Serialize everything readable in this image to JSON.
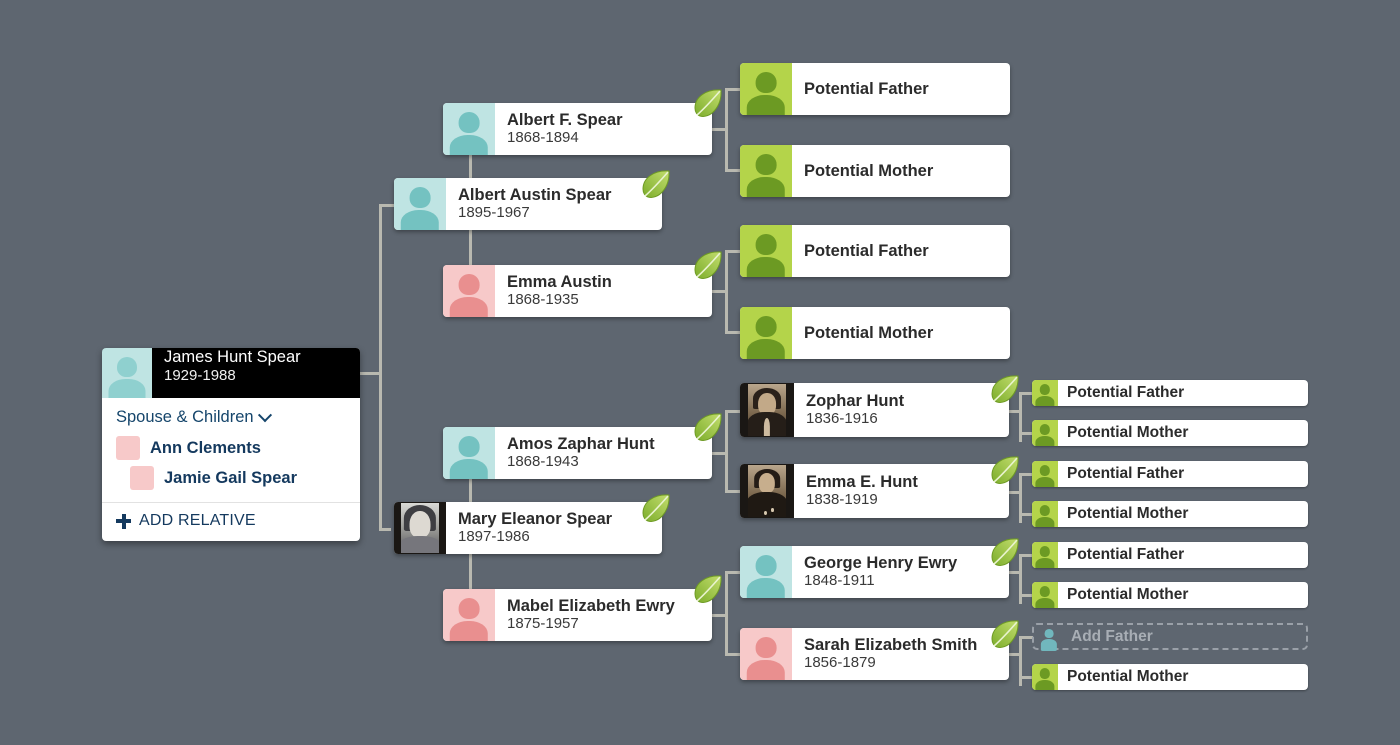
{
  "theme": {
    "background": "#5e6670",
    "connector": "#b9b9b0",
    "card_bg": "#ffffff",
    "focus_header_bg": "#000000",
    "male_avatar": "#bfe4e3",
    "female_avatar": "#f7c9c9",
    "potential_avatar": "#b4d44a",
    "link_text": "#14395e",
    "placeholder_text": "#a8aeb5"
  },
  "focus_person": {
    "name": "James Hunt Spear",
    "years": "1929-1988",
    "avatar_icon": "male-silhouette-icon",
    "section_label": "Spouse & Children",
    "chevron_icon": "chevron-down-icon",
    "relatives": [
      {
        "name": "Ann Clements",
        "relation": "spouse",
        "avatar_icon": "female-silhouette-icon"
      },
      {
        "name": "Jamie Gail Spear",
        "relation": "child",
        "avatar_icon": "female-silhouette-icon"
      }
    ],
    "add_relative_label": "ADD RELATIVE",
    "add_icon": "plus-icon"
  },
  "generation_2": [
    {
      "id": "albert-austin-spear",
      "name": "Albert Austin Spear",
      "years": "1895-1967",
      "avatar": "male",
      "avatar_icon": "male-silhouette-icon",
      "hint_icon": "leaf-hint-icon"
    },
    {
      "id": "mary-eleanor-spear",
      "name": "Mary Eleanor Spear",
      "years": "1897-1986",
      "avatar": "photo-gray",
      "avatar_icon": "portrait-photo",
      "hint_icon": "leaf-hint-icon"
    }
  ],
  "generation_3": [
    {
      "id": "albert-f-spear",
      "name": "Albert F. Spear",
      "years": "1868-1894",
      "avatar": "male",
      "avatar_icon": "male-silhouette-icon",
      "hint_icon": "leaf-hint-icon"
    },
    {
      "id": "emma-austin",
      "name": "Emma Austin",
      "years": "1868-1935",
      "avatar": "female",
      "avatar_icon": "female-silhouette-icon",
      "hint_icon": "leaf-hint-icon"
    },
    {
      "id": "amos-zaphar-hunt",
      "name": "Amos Zaphar Hunt",
      "years": "1868-1943",
      "avatar": "male",
      "avatar_icon": "male-silhouette-icon",
      "hint_icon": "leaf-hint-icon"
    },
    {
      "id": "mabel-elizabeth-ewry",
      "name": "Mabel Elizabeth Ewry",
      "years": "1875-1957",
      "avatar": "female",
      "avatar_icon": "female-silhouette-icon",
      "hint_icon": "leaf-hint-icon"
    }
  ],
  "generation_4": [
    {
      "id": "zophar-hunt",
      "name": "Zophar Hunt",
      "years": "1836-1916",
      "avatar": "photo-sepia",
      "avatar_icon": "portrait-photo",
      "hint_icon": "leaf-hint-icon"
    },
    {
      "id": "emma-e-hunt",
      "name": "Emma E. Hunt",
      "years": "1838-1919",
      "avatar": "photo-sepia",
      "avatar_icon": "portrait-photo",
      "hint_icon": "leaf-hint-icon"
    },
    {
      "id": "george-henry-ewry",
      "name": "George Henry Ewry",
      "years": "1848-1911",
      "avatar": "male",
      "avatar_icon": "male-silhouette-icon",
      "hint_icon": "leaf-hint-icon"
    },
    {
      "id": "sarah-elizabeth-smith",
      "name": "Sarah Elizabeth Smith",
      "years": "1856-1879",
      "avatar": "female",
      "avatar_icon": "female-silhouette-icon",
      "hint_icon": "leaf-hint-icon"
    }
  ],
  "potential_large": [
    {
      "id": "pf-1",
      "label": "Potential Father",
      "avatar_icon": "potential-father-icon"
    },
    {
      "id": "pm-1",
      "label": "Potential Mother",
      "avatar_icon": "potential-mother-icon"
    },
    {
      "id": "pf-2",
      "label": "Potential Father",
      "avatar_icon": "potential-father-icon"
    },
    {
      "id": "pm-2",
      "label": "Potential Mother",
      "avatar_icon": "potential-mother-icon"
    }
  ],
  "potential_small": [
    {
      "id": "pf-3",
      "label": "Potential Father",
      "avatar_icon": "potential-father-icon"
    },
    {
      "id": "pm-3",
      "label": "Potential Mother",
      "avatar_icon": "potential-mother-icon"
    },
    {
      "id": "pf-4",
      "label": "Potential Father",
      "avatar_icon": "potential-father-icon"
    },
    {
      "id": "pm-4",
      "label": "Potential Mother",
      "avatar_icon": "potential-mother-icon"
    },
    {
      "id": "pf-5",
      "label": "Potential Father",
      "avatar_icon": "potential-father-icon"
    },
    {
      "id": "pm-5",
      "label": "Potential Mother",
      "avatar_icon": "potential-mother-icon"
    },
    {
      "id": "pm-6",
      "label": "Potential Mother",
      "avatar_icon": "potential-mother-icon"
    }
  ],
  "add_father": {
    "label": "Add Father",
    "avatar_icon": "male-silhouette-icon"
  }
}
